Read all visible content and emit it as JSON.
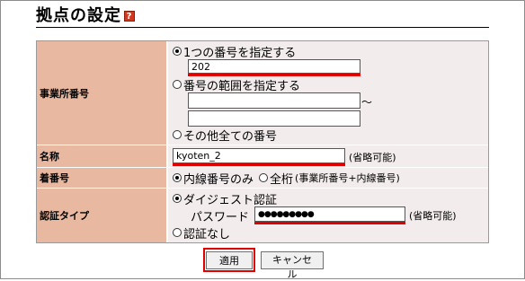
{
  "page": {
    "title": "拠点の設定",
    "help_icon": "?"
  },
  "form": {
    "office_number": {
      "label": "事業所番号",
      "option_single": "1つの番号を指定する",
      "single_value": "202",
      "option_range": "番号の範囲を指定する",
      "range_from": "",
      "range_to": "",
      "range_sep": "～",
      "option_all_others": "その他全ての番号",
      "selected": "single"
    },
    "name": {
      "label": "名称",
      "value": "kyoten_2",
      "note": "(省略可能)"
    },
    "incoming_number": {
      "label": "着番号",
      "option_line_only": "内線番号のみ",
      "option_full_digits": "全桁",
      "full_digits_note": "(事業所番号+内線番号)",
      "selected": "line_only"
    },
    "auth_type": {
      "label": "認証タイプ",
      "option_digest": "ダイジェスト認証",
      "password_label": "パスワード",
      "password_value": "●●●●●●●●●",
      "password_note": "(省略可能)",
      "option_none": "認証なし",
      "selected": "digest"
    }
  },
  "buttons": {
    "apply": "適用",
    "cancel": "キャンセル"
  },
  "colors": {
    "label_bg": "#e8b8a0",
    "value_bg": "#f2ecec",
    "highlight": "#e00000"
  }
}
